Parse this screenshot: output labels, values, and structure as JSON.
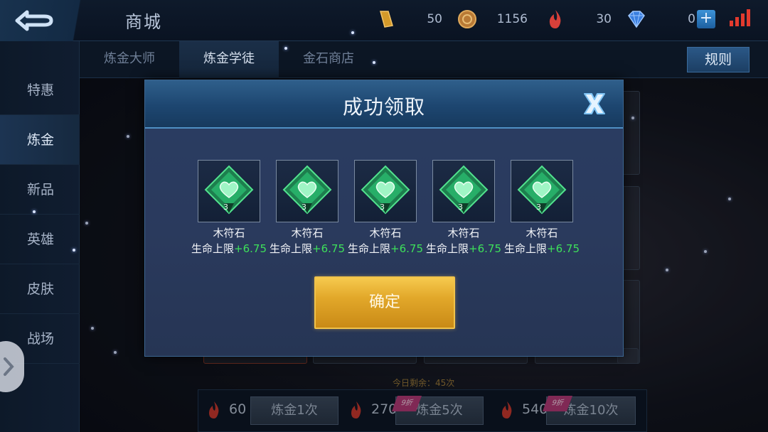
{
  "topbar": {
    "title": "商城",
    "resources": [
      {
        "name": "coupon",
        "icon": "coupon-icon",
        "value": "50",
        "color": "#d49a2a"
      },
      {
        "name": "gold",
        "icon": "gold-coin-icon",
        "value": "1156",
        "color": "#c98a3a"
      },
      {
        "name": "alchemy",
        "icon": "alchemy-flame-icon",
        "value": "30",
        "color": "#d8403a"
      },
      {
        "name": "diamond",
        "icon": "diamond-icon",
        "value": "0",
        "color": "#3a7fe0"
      }
    ],
    "plus_label": "+"
  },
  "tabs": [
    "炼金大师",
    "炼金学徒",
    "金石商店"
  ],
  "active_tab": 1,
  "rule_label": "规则",
  "sidebar": {
    "items": [
      "特惠",
      "炼金",
      "新品",
      "英雄",
      "皮肤",
      "战场"
    ],
    "active": 1
  },
  "dialog": {
    "title": "成功领取",
    "rewards": [
      {
        "name": "木符石",
        "level": "3",
        "stat": "生命上限",
        "bonus": "+6.75"
      },
      {
        "name": "木符石",
        "level": "3",
        "stat": "生命上限",
        "bonus": "+6.75"
      },
      {
        "name": "木符石",
        "level": "3",
        "stat": "生命上限",
        "bonus": "+6.75"
      },
      {
        "name": "木符石",
        "level": "3",
        "stat": "生命上限",
        "bonus": "+6.75"
      },
      {
        "name": "木符石",
        "level": "3",
        "stat": "生命上限",
        "bonus": "+6.75"
      }
    ],
    "confirm_label": "确定"
  },
  "bottom": {
    "remaining": "今日剩余：45次",
    "options": [
      {
        "cost": "60",
        "label": "炼金1次",
        "tag": ""
      },
      {
        "cost": "270",
        "label": "炼金5次",
        "tag": "9折"
      },
      {
        "cost": "540",
        "label": "炼金10次",
        "tag": "9折"
      }
    ]
  },
  "colors": {
    "accent_gold": "#e2a82a",
    "bonus_green": "#3ee05a",
    "dialog_header": "#1d4670",
    "gem_green": "#2fcf7a"
  }
}
